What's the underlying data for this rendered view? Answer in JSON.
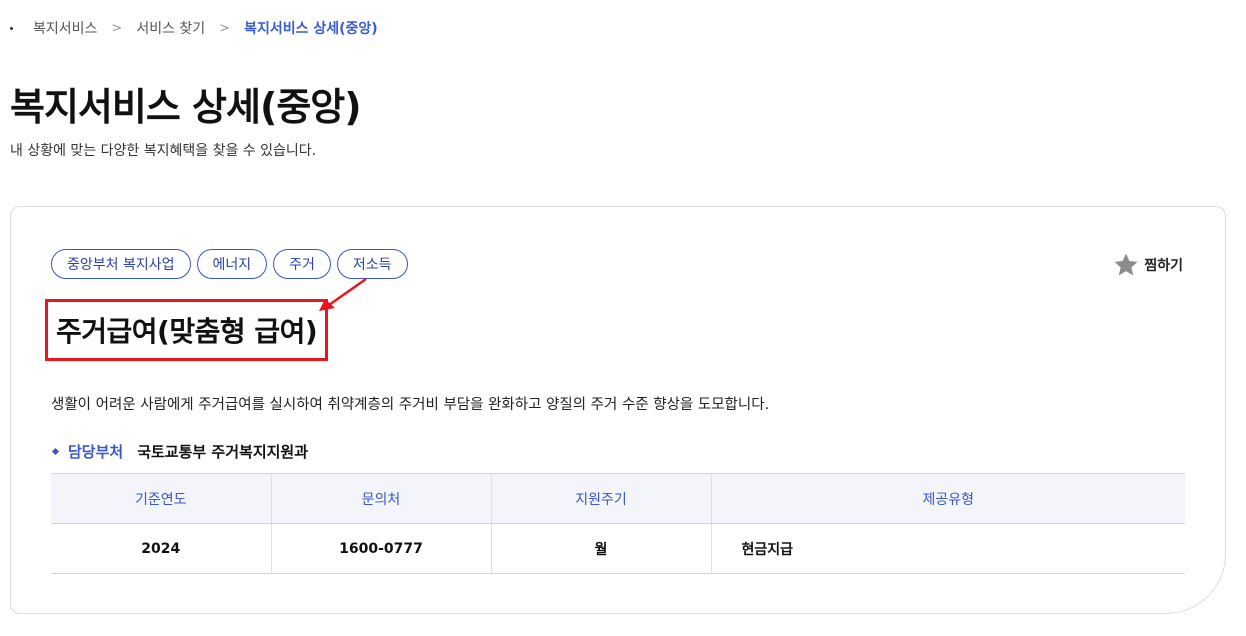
{
  "breadcrumb": {
    "items": [
      "복지서비스",
      "서비스 찾기",
      "복지서비스 상세(중앙)"
    ],
    "separator": ">"
  },
  "header": {
    "title": "복지서비스 상세(중앙)",
    "description": "내 상황에 맞는 다양한 복지혜택을 찾을 수 있습니다."
  },
  "service": {
    "tags": [
      "중앙부처 복지사업",
      "에너지",
      "주거",
      "저소득"
    ],
    "favorite_label": "찜하기",
    "title": "주거급여(맞춤형 급여)",
    "description": "생활이 어려운 사람에게 주거급여를 실시하여 취약계층의 주거비 부담을 완화하고 양질의 주거 수준 향상을 도모합니다.",
    "department": {
      "label": "담당부처",
      "value": "국토교통부 주거복지지원과"
    },
    "table": {
      "headers": [
        "기준연도",
        "문의처",
        "지원주기",
        "제공유형"
      ],
      "rows": [
        [
          "2024",
          "1600-0777",
          "월",
          "현금지급"
        ]
      ]
    }
  },
  "colors": {
    "accent": "#3a56c8",
    "highlight_box": "#e8171d",
    "star": "#8c8c8c"
  },
  "icons": [
    "star-icon",
    "diamond-icon",
    "chevron-right-icon"
  ]
}
